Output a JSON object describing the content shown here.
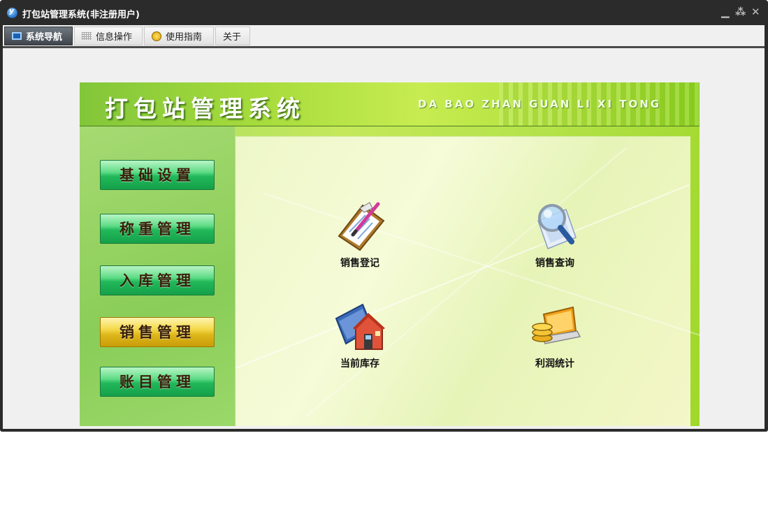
{
  "window": {
    "title": "打包站管理系统(非注册用户)",
    "controls": {
      "minimize": "▁",
      "restore": "⁂",
      "close": "✕"
    }
  },
  "menu": {
    "items": [
      {
        "label": "系统导航",
        "icon": "monitor-icon",
        "active": true
      },
      {
        "label": "信息操作",
        "icon": "grid-icon",
        "active": false
      },
      {
        "label": "使用指南",
        "icon": "guide-icon",
        "active": false
      },
      {
        "label": "关于",
        "icon": "",
        "active": false
      }
    ]
  },
  "banner": {
    "title": "打包站管理系统",
    "subtitle": "DA BAO ZHAN GUAN LI XI TONG"
  },
  "nav": {
    "buttons": [
      {
        "label": "基础设置",
        "active": false
      },
      {
        "label": "称重管理",
        "active": false
      },
      {
        "label": "入库管理",
        "active": false
      },
      {
        "label": "销售管理",
        "active": true
      },
      {
        "label": "账目管理",
        "active": false
      }
    ]
  },
  "features": [
    {
      "label": "销售登记",
      "icon": "clipboard-pen-icon"
    },
    {
      "label": "销售查询",
      "icon": "magnifier-icon"
    },
    {
      "label": "当前库存",
      "icon": "house-book-icon"
    },
    {
      "label": "利润统计",
      "icon": "coins-laptop-icon"
    }
  ],
  "colors": {
    "nav_green": "#22b85a",
    "nav_active_gold": "#ddb61a",
    "banner_green": "#a8dc3c"
  }
}
